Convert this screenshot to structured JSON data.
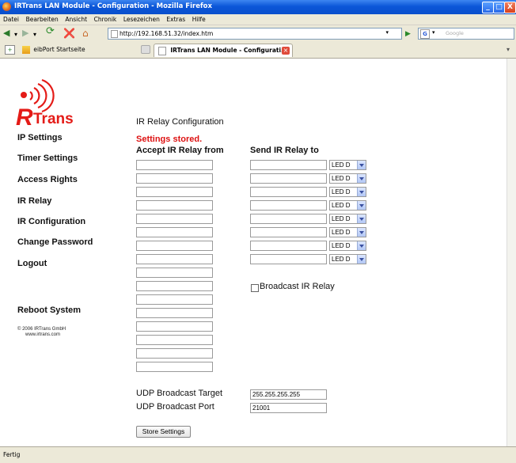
{
  "window": {
    "title": "IRTrans LAN Module - Configuration - Mozilla Firefox",
    "buttons": [
      "_",
      "□",
      "X"
    ]
  },
  "menu": [
    "Datei",
    "Bearbeiten",
    "Ansicht",
    "Chronik",
    "Lesezeichen",
    "Extras",
    "Hilfe"
  ],
  "navbar": {
    "url": "http://192.168.51.32/index.htm",
    "search_placeholder": "Google"
  },
  "tabs": [
    {
      "label": "eibPort Startseite"
    },
    {
      "label": "IRTrans LAN Module - Configurati..."
    }
  ],
  "logo": {
    "text": "Trans",
    "letters": "iR"
  },
  "sidebar": {
    "items": [
      {
        "label": "IP Settings"
      },
      {
        "label": "Timer Settings"
      },
      {
        "label": "Access Rights"
      },
      {
        "label": "IR Relay"
      },
      {
        "label": "IR Configuration"
      },
      {
        "label": "Change Password"
      },
      {
        "label": "Logout"
      }
    ],
    "reboot": "Reboot System",
    "copyright": "© 2006 IRTrans GmbH",
    "website": "www.irtrans.com"
  },
  "main": {
    "heading": "IR Relay Configuration",
    "status": "Settings stored.",
    "status_color": "#dd1111",
    "accept_header": "Accept IR Relay from",
    "send_header": "Send IR Relay to",
    "accept_fields": [
      "",
      "",
      "",
      "",
      "",
      "",
      "",
      "",
      "",
      "",
      "",
      "",
      "",
      "",
      "",
      ""
    ],
    "send_rows": [
      {
        "value": "",
        "led": "LED D"
      },
      {
        "value": "",
        "led": "LED D"
      },
      {
        "value": "",
        "led": "LED D"
      },
      {
        "value": "",
        "led": "LED D"
      },
      {
        "value": "",
        "led": "LED D"
      },
      {
        "value": "",
        "led": "LED D"
      },
      {
        "value": "",
        "led": "LED D"
      },
      {
        "value": "",
        "led": "LED D"
      }
    ],
    "broadcast_label": "Broadcast IR Relay",
    "udp_target_label": "UDP Broadcast Target",
    "udp_target_value": "255.255.255.255",
    "udp_port_label": "UDP Broadcast Port",
    "udp_port_value": "21001",
    "store_button": "Store Settings"
  },
  "status_bar": "Fertig"
}
